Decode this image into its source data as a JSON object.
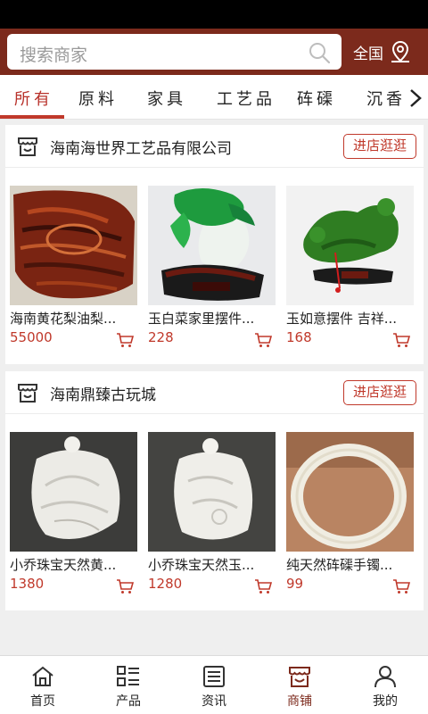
{
  "header": {
    "search_placeholder": "搜索商家",
    "region_label": "全国"
  },
  "tabs": [
    {
      "label": "所有",
      "active": true
    },
    {
      "label": "原料",
      "active": false
    },
    {
      "label": "家具",
      "active": false
    },
    {
      "label": "工艺品",
      "active": false
    },
    {
      "label": "砗磲",
      "active": false
    },
    {
      "label": "沉香",
      "active": false
    }
  ],
  "shops": [
    {
      "name": "海南海世界工艺品有限公司",
      "visit_label": "进店逛逛",
      "products": [
        {
          "title": "海南黄花梨油梨...",
          "price": "55000"
        },
        {
          "title": "玉白菜家里摆件...",
          "price": "228"
        },
        {
          "title": "玉如意摆件 吉祥...",
          "price": "168"
        }
      ]
    },
    {
      "name": "海南鼎臻古玩城",
      "visit_label": "进店逛逛",
      "products": [
        {
          "title": "小乔珠宝天然黄...",
          "price": "1380"
        },
        {
          "title": "小乔珠宝天然玉...",
          "price": "1280"
        },
        {
          "title": "纯天然砗磲手镯...",
          "price": "99"
        }
      ]
    }
  ],
  "bottom_nav": [
    {
      "label": "首页",
      "icon": "home-icon",
      "active": false
    },
    {
      "label": "产品",
      "icon": "list-icon",
      "active": false
    },
    {
      "label": "资讯",
      "icon": "news-icon",
      "active": false
    },
    {
      "label": "商铺",
      "icon": "store-icon",
      "active": true
    },
    {
      "label": "我的",
      "icon": "user-icon",
      "active": false
    }
  ],
  "colors": {
    "header_bg": "#7c2a1c",
    "accent": "#c0392b",
    "price": "#c0392b"
  }
}
